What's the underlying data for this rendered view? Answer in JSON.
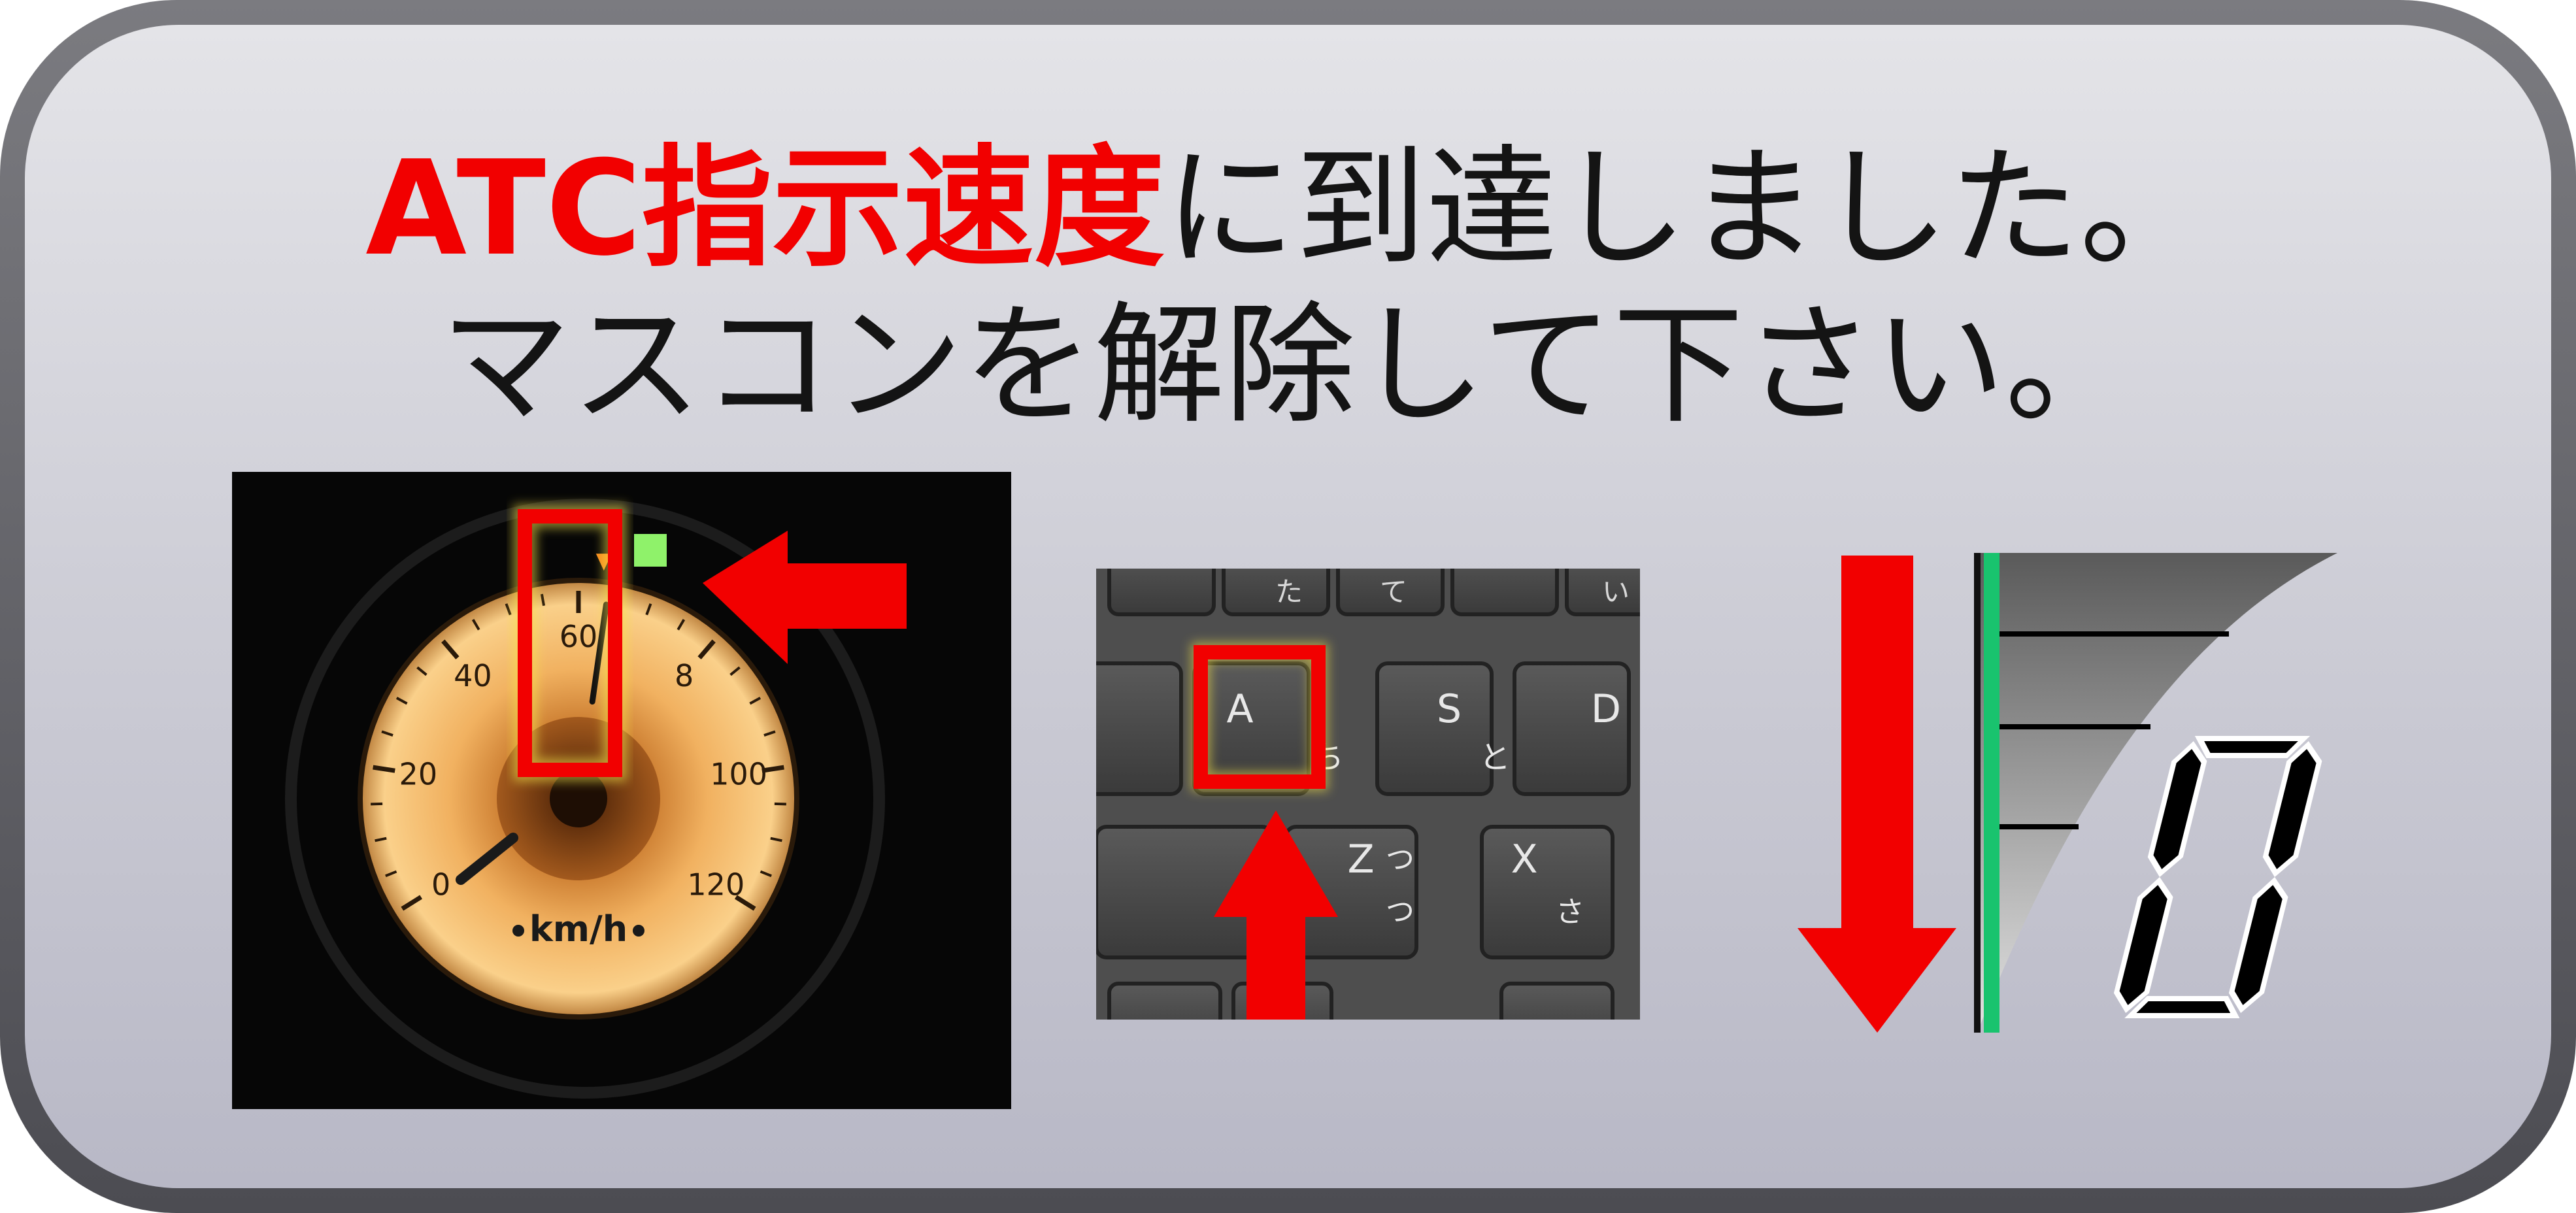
{
  "message": {
    "line1_highlight": "ATC指示速度",
    "line1_rest": "に到達しました。",
    "line2": "マスコンを解除して下さい。",
    "highlight_color": "#f20000"
  },
  "speedometer": {
    "tick_labels": [
      "0",
      "20",
      "40",
      "60",
      "8",
      "100",
      "120"
    ],
    "unit": "km/h",
    "needle_value_kmh": 64,
    "signal_marker_kmh": 63
  },
  "keyboard": {
    "keys": [
      {
        "main": "た",
        "sub": ""
      },
      {
        "main": "て",
        "sub": ""
      },
      {
        "main": "い",
        "sub": ""
      },
      {
        "main": "A",
        "sub": "ち"
      },
      {
        "main": "S",
        "sub": "と"
      },
      {
        "main": "D",
        "sub": ""
      },
      {
        "main": "Z",
        "sub": "つ"
      },
      {
        "main": "X",
        "sub": "さ"
      }
    ],
    "highlighted_key": "A"
  },
  "notch_display": {
    "digit": "0",
    "accent_color": "#19c36e",
    "arrow_color": "#f20000"
  }
}
